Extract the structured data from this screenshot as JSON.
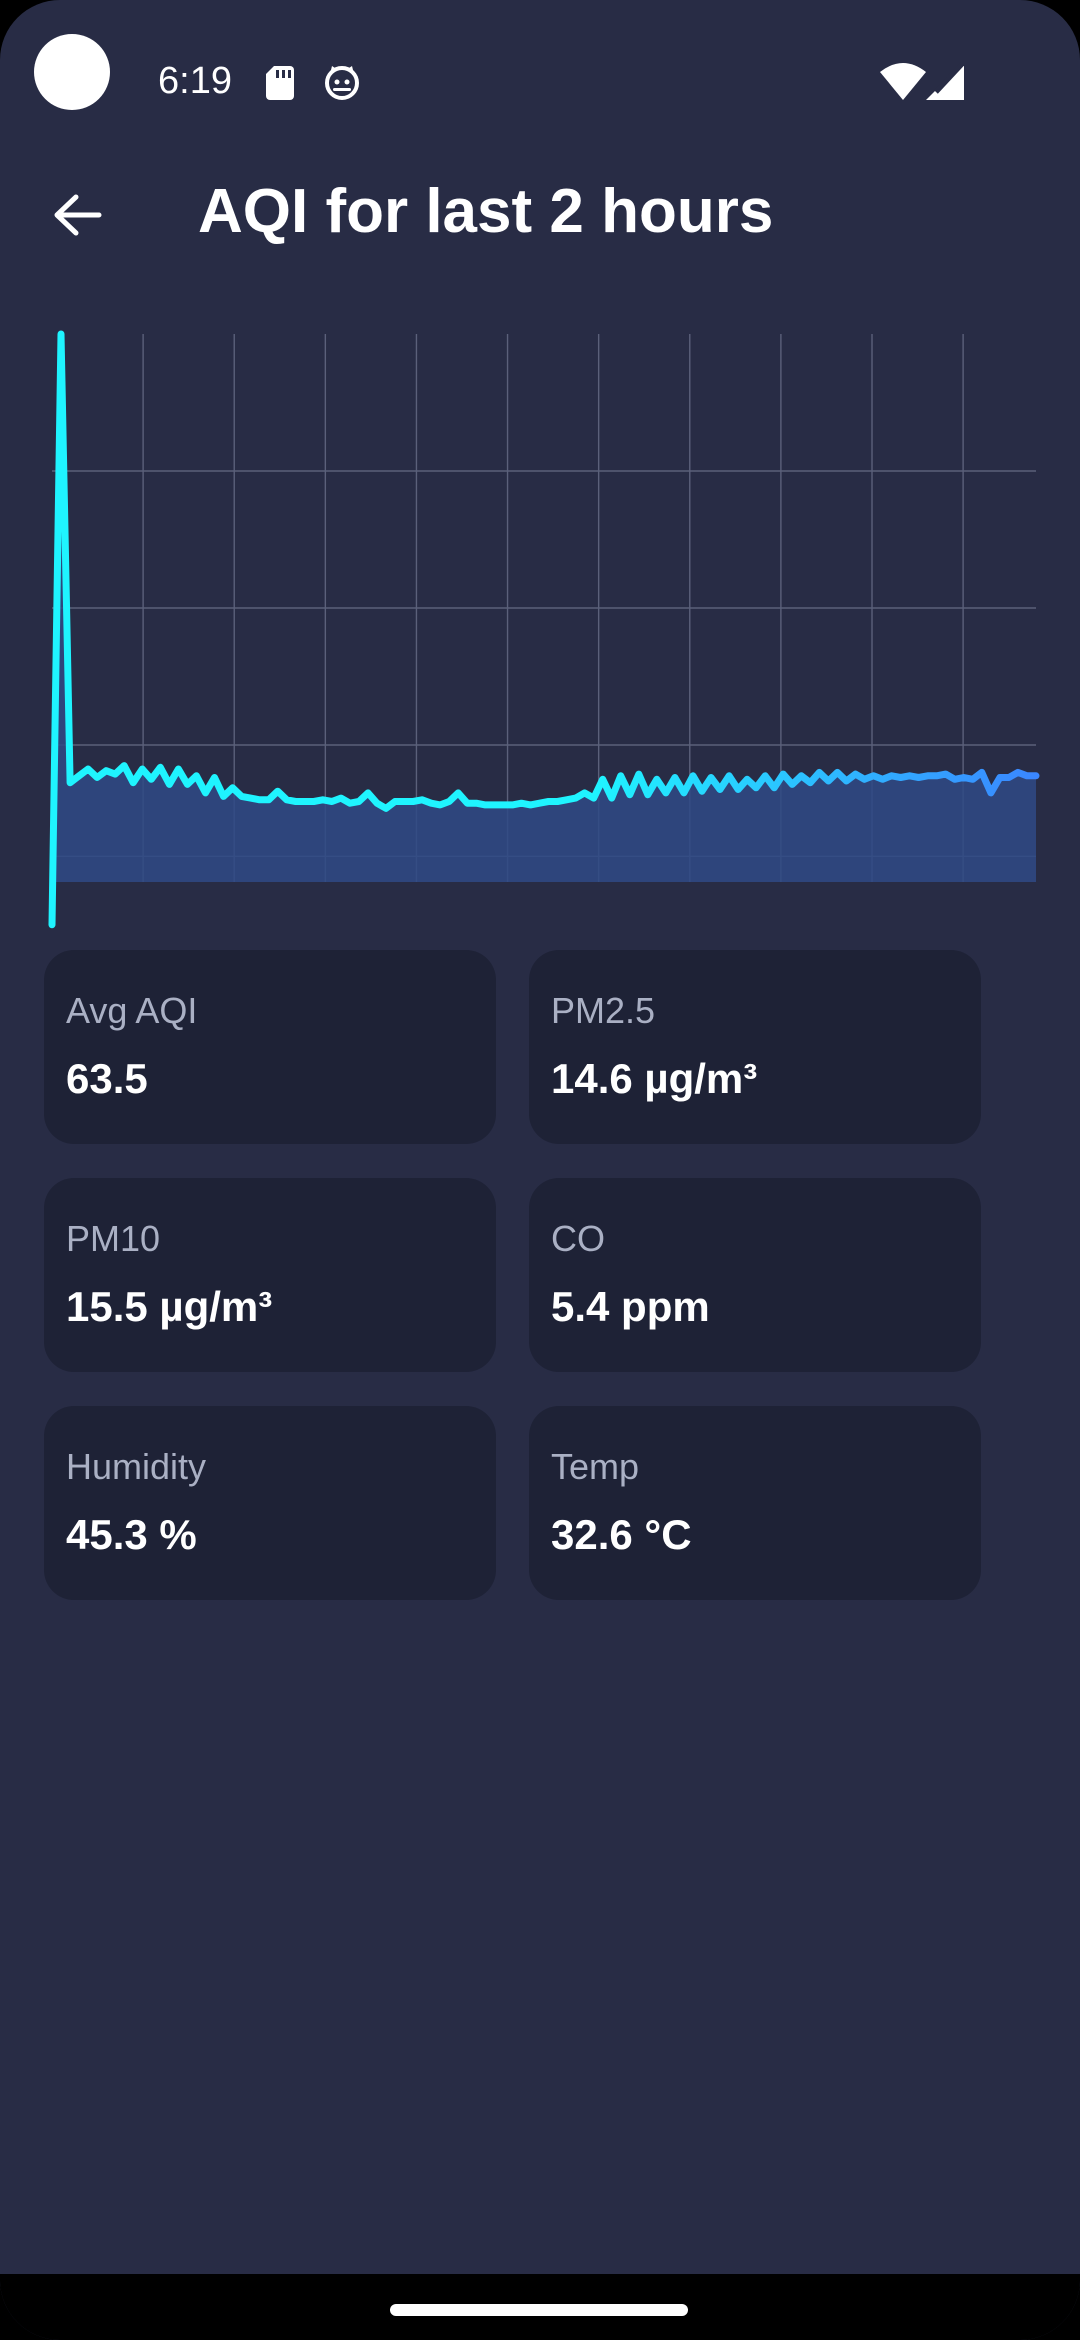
{
  "status": {
    "time": "6:19",
    "icons": [
      "sd-card-icon",
      "cat-face-icon",
      "wifi-icon",
      "cell-signal-icon"
    ]
  },
  "app_bar": {
    "back_icon": "arrow-back-icon",
    "title": "AQI for last 2 hours"
  },
  "colors": {
    "background": "#282c45",
    "card_background": "#1e2236",
    "line_start": "#1ff4ff",
    "line_end": "#3a86ff",
    "area_fill": "#2f4a86"
  },
  "chart_data": {
    "type": "area",
    "grid": true,
    "title": "",
    "xlabel": "",
    "ylabel": "",
    "ylim": [
      0,
      320
    ],
    "x": [
      0,
      1,
      2,
      3,
      4,
      5,
      6,
      7,
      8,
      9,
      10,
      11,
      12,
      13,
      14,
      15,
      16,
      17,
      18,
      19,
      20,
      21,
      22,
      23,
      24,
      25,
      26,
      27,
      28,
      29,
      30,
      31,
      32,
      33,
      34,
      35,
      36,
      37,
      38,
      39,
      40,
      41,
      42,
      43,
      44,
      45,
      46,
      47,
      48,
      49,
      50,
      51,
      52,
      53,
      54,
      55,
      56,
      57,
      58,
      59,
      60,
      61,
      62,
      63,
      64,
      65,
      66,
      67,
      68,
      69,
      70,
      71,
      72,
      73,
      74,
      75,
      76,
      77,
      78,
      79,
      80,
      81,
      82,
      83,
      84,
      85,
      86,
      87,
      88,
      89,
      90,
      91,
      92,
      93,
      94,
      95,
      96,
      97,
      98,
      99,
      100,
      101,
      102,
      103,
      104,
      105,
      106,
      107,
      108,
      109
    ],
    "values": [
      -25,
      320,
      58,
      62,
      66,
      61,
      65,
      63,
      68,
      58,
      66,
      60,
      67,
      57,
      66,
      57,
      62,
      52,
      61,
      50,
      55,
      50,
      49,
      48,
      48,
      53,
      48,
      47,
      47,
      47,
      48,
      47,
      49,
      46,
      47,
      52,
      46,
      43,
      47,
      47,
      47,
      48,
      46,
      45,
      47,
      52,
      46,
      46,
      45,
      45,
      45,
      45,
      46,
      45,
      46,
      47,
      47,
      48,
      49,
      52,
      49,
      60,
      49,
      62,
      51,
      63,
      51,
      60,
      52,
      61,
      52,
      62,
      53,
      61,
      54,
      62,
      54,
      60,
      55,
      62,
      55,
      63,
      57,
      62,
      58,
      64,
      59,
      64,
      59,
      63,
      60,
      62,
      60,
      62,
      61,
      62,
      61,
      62,
      62,
      63,
      60,
      61,
      60,
      64,
      52,
      61,
      61,
      64,
      62,
      62
    ]
  },
  "stats": [
    {
      "label": "Avg AQI",
      "value": "63.5"
    },
    {
      "label": "PM2.5",
      "value": "14.6 µg/m³"
    },
    {
      "label": "PM10",
      "value": "15.5 µg/m³"
    },
    {
      "label": "CO",
      "value": "5.4 ppm"
    },
    {
      "label": "Humidity",
      "value": "45.3 %"
    },
    {
      "label": "Temp",
      "value": "32.6 °C"
    }
  ]
}
